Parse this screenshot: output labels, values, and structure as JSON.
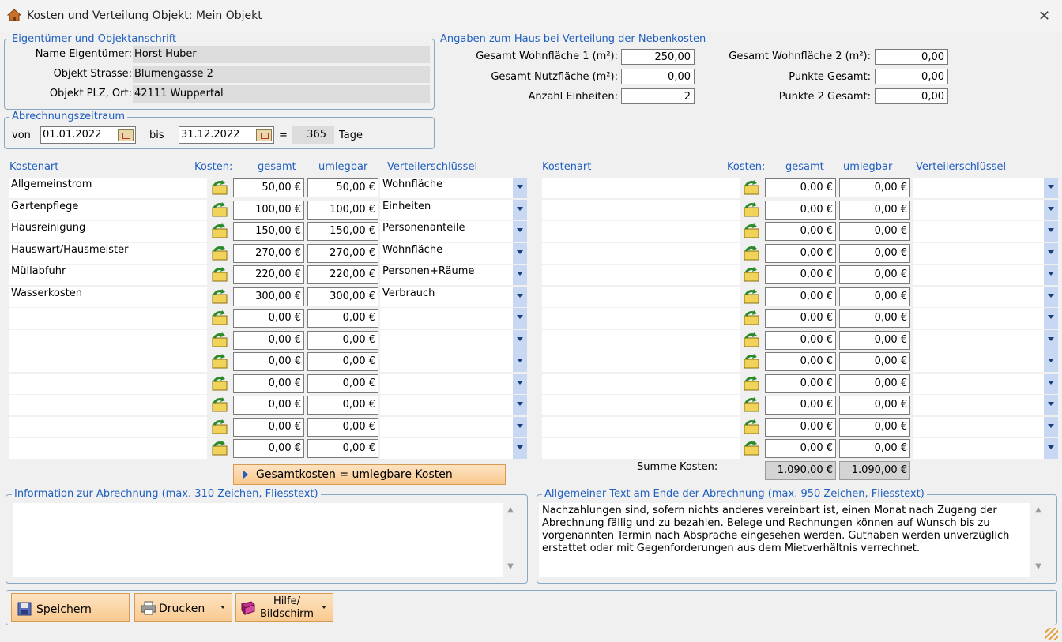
{
  "window": {
    "title": "Kosten und Verteilung Objekt: Mein Objekt"
  },
  "owner": {
    "legend": "Eigentümer und Objektanschrift",
    "name_label": "Name Eigentümer:",
    "name_value": "Horst Huber",
    "street_label": "Objekt Strasse:",
    "street_value": "Blumengasse 2",
    "city_label": "Objekt PLZ, Ort:",
    "city_value": "42111 Wuppertal"
  },
  "house": {
    "legend": "Angaben zum Haus bei Verteilung der Nebenkosten",
    "wohn1_label": "Gesamt Wohnfläche 1 (m²):",
    "wohn1_value": "250,00",
    "nutz_label": "Gesamt Nutzfläche (m²):",
    "nutz_value": "0,00",
    "einheiten_label": "Anzahl Einheiten:",
    "einheiten_value": "2",
    "wohn2_label": "Gesamt Wohnfläche 2 (m²):",
    "wohn2_value": "0,00",
    "punkte_label": "Punkte Gesamt:",
    "punkte_value": "0,00",
    "punkte2_label": "Punkte 2 Gesamt:",
    "punkte2_value": "0,00"
  },
  "period": {
    "legend": "Abrechnungszeitraum",
    "von_label": "von",
    "von_value": "01.01.2022",
    "bis_label": "bis",
    "bis_value": "31.12.2022",
    "eq": "=",
    "days": "365",
    "days_label": "Tage"
  },
  "headers": {
    "kostenart": "Kostenart",
    "kosten": "Kosten:",
    "gesamt": "gesamt",
    "umlegbar": "umlegbar",
    "schluessel": "Verteilerschlüssel"
  },
  "left_rows": [
    {
      "name": "Allgemeinstrom",
      "gesamt": "50,00 €",
      "umlegbar": "50,00 €",
      "key": "Wohnfläche"
    },
    {
      "name": "Gartenpflege",
      "gesamt": "100,00 €",
      "umlegbar": "100,00 €",
      "key": "Einheiten"
    },
    {
      "name": "Hausreinigung",
      "gesamt": "150,00 €",
      "umlegbar": "150,00 €",
      "key": "Personenanteile"
    },
    {
      "name": "Hauswart/Hausmeister",
      "gesamt": "270,00 €",
      "umlegbar": "270,00 €",
      "key": "Wohnfläche"
    },
    {
      "name": "Müllabfuhr",
      "gesamt": "220,00 €",
      "umlegbar": "220,00 €",
      "key": "Personen+Räume"
    },
    {
      "name": "Wasserkosten",
      "gesamt": "300,00 €",
      "umlegbar": "300,00 €",
      "key": "Verbrauch"
    },
    {
      "name": "",
      "gesamt": "0,00 €",
      "umlegbar": "0,00 €",
      "key": ""
    },
    {
      "name": "",
      "gesamt": "0,00 €",
      "umlegbar": "0,00 €",
      "key": ""
    },
    {
      "name": "",
      "gesamt": "0,00 €",
      "umlegbar": "0,00 €",
      "key": ""
    },
    {
      "name": "",
      "gesamt": "0,00 €",
      "umlegbar": "0,00 €",
      "key": ""
    },
    {
      "name": "",
      "gesamt": "0,00 €",
      "umlegbar": "0,00 €",
      "key": ""
    },
    {
      "name": "",
      "gesamt": "0,00 €",
      "umlegbar": "0,00 €",
      "key": ""
    },
    {
      "name": "",
      "gesamt": "0,00 €",
      "umlegbar": "0,00 €",
      "key": ""
    }
  ],
  "right_rows": [
    {
      "gesamt": "0,00 €",
      "umlegbar": "0,00 €"
    },
    {
      "gesamt": "0,00 €",
      "umlegbar": "0,00 €"
    },
    {
      "gesamt": "0,00 €",
      "umlegbar": "0,00 €"
    },
    {
      "gesamt": "0,00 €",
      "umlegbar": "0,00 €"
    },
    {
      "gesamt": "0,00 €",
      "umlegbar": "0,00 €"
    },
    {
      "gesamt": "0,00 €",
      "umlegbar": "0,00 €"
    },
    {
      "gesamt": "0,00 €",
      "umlegbar": "0,00 €"
    },
    {
      "gesamt": "0,00 €",
      "umlegbar": "0,00 €"
    },
    {
      "gesamt": "0,00 €",
      "umlegbar": "0,00 €"
    },
    {
      "gesamt": "0,00 €",
      "umlegbar": "0,00 €"
    },
    {
      "gesamt": "0,00 €",
      "umlegbar": "0,00 €"
    },
    {
      "gesamt": "0,00 €",
      "umlegbar": "0,00 €"
    },
    {
      "gesamt": "0,00 €",
      "umlegbar": "0,00 €"
    }
  ],
  "summe": {
    "label": "Summe Kosten:",
    "gesamt": "1.090,00 €",
    "umlegbar": "1.090,00 €"
  },
  "equalize_button": "Gesamtkosten = umlegbare Kosten",
  "info": {
    "legend": "Information zur Abrechnung (max. 310 Zeichen, Fliesstext)",
    "text": ""
  },
  "general": {
    "legend": "Allgemeiner Text am Ende der Abrechnung (max. 950 Zeichen, Fliesstext)",
    "text": "Nachzahlungen sind, sofern nichts anderes vereinbart ist, einen Monat nach Zugang der Abrechnung fällig und zu bezahlen. Belege und Rechnungen können auf Wunsch bis zu vorgenannten Termin nach Absprache eingesehen werden. Guthaben werden unverzüglich erstattet oder mit Gegenforderungen aus dem Mietverhältnis verrechnet."
  },
  "footer": {
    "save": "Speichern",
    "print": "Drucken",
    "help_line1": "Hilfe/",
    "help_line2": "Bildschirm"
  }
}
